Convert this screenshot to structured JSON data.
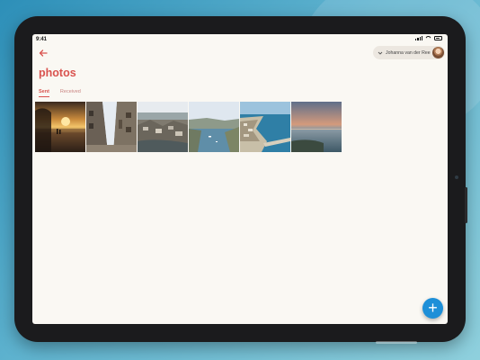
{
  "status_bar": {
    "time": "9:41",
    "icons": [
      "signal-icon",
      "wifi-icon",
      "battery-icon"
    ]
  },
  "header": {
    "back_icon": "arrow-left-icon",
    "account": {
      "name": "Johanna van der Ree",
      "dropdown_icon": "chevron-down-icon",
      "avatar": "avatar"
    }
  },
  "page": {
    "title": "photos",
    "tabs": [
      {
        "label": "Sent",
        "active": true
      },
      {
        "label": "Received",
        "active": false
      }
    ]
  },
  "photos": [
    {
      "subject": "sunset-over-beach"
    },
    {
      "subject": "narrow-town-street"
    },
    {
      "subject": "rocky-coastal-village"
    },
    {
      "subject": "harbor-bay"
    },
    {
      "subject": "aerial-coastline"
    },
    {
      "subject": "sea-at-dusk"
    }
  ],
  "fab": {
    "icon": "plus-icon",
    "glyph": "+"
  },
  "colors": {
    "accent": "#d9534f",
    "screen_background": "#faf8f3",
    "fab": "#1d8fd8",
    "device_frame": "#1b1b1d"
  }
}
